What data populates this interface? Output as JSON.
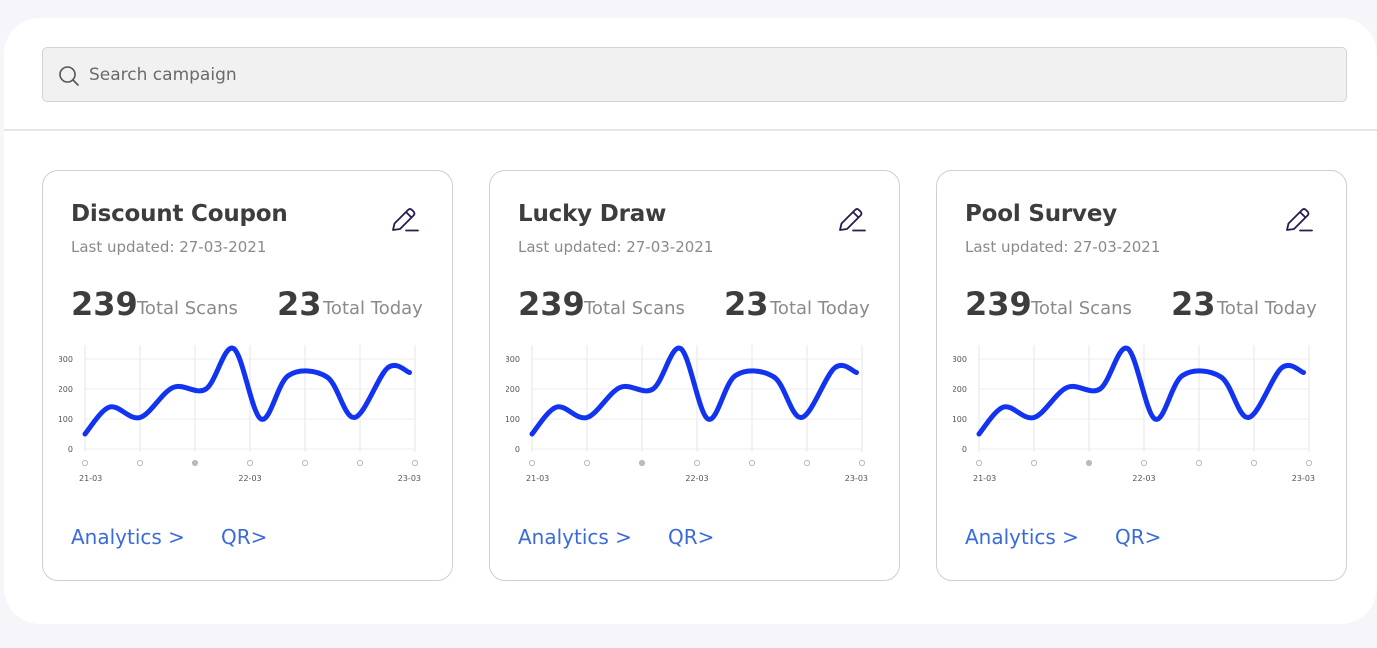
{
  "search": {
    "placeholder": "Search campaign",
    "value": ""
  },
  "chart_data": {
    "type": "line",
    "ylim": [
      0,
      340
    ],
    "y_ticks": [
      "0",
      "100",
      "200",
      "300"
    ],
    "x_labels": [
      "21-03",
      "22-03",
      "23-03"
    ],
    "x": [
      0,
      0.45,
      1,
      1.6,
      2.2,
      2.7,
      3.2,
      3.7,
      4.4,
      4.9,
      5.5,
      5.9
    ],
    "values": [
      50,
      140,
      105,
      205,
      200,
      335,
      100,
      245,
      240,
      105,
      270,
      255
    ]
  },
  "cards": [
    {
      "title": "Discount Coupon",
      "updated": "Last updated: 27-03-2021",
      "total_scans": "239",
      "total_scans_label": "Total Scans",
      "total_today": "23",
      "total_today_label": "Total Today",
      "analytics_label": "Analytics >",
      "qr_label": "QR>"
    },
    {
      "title": "Lucky Draw",
      "updated": "Last updated: 27-03-2021",
      "total_scans": "239",
      "total_scans_label": "Total Scans",
      "total_today": "23",
      "total_today_label": "Total Today",
      "analytics_label": "Analytics >",
      "qr_label": "QR>"
    },
    {
      "title": "Pool Survey",
      "updated": "Last updated: 27-03-2021",
      "total_scans": "239",
      "total_scans_label": "Total Scans",
      "total_today": "23",
      "total_today_label": "Total Today",
      "analytics_label": "Analytics >",
      "qr_label": "QR>"
    }
  ],
  "colors": {
    "line": "#1234f0",
    "link": "#3a6bd8",
    "edit_icon": "#2b1b4f"
  },
  "icons": {
    "search": "search-icon",
    "edit": "edit-pencil-icon"
  }
}
